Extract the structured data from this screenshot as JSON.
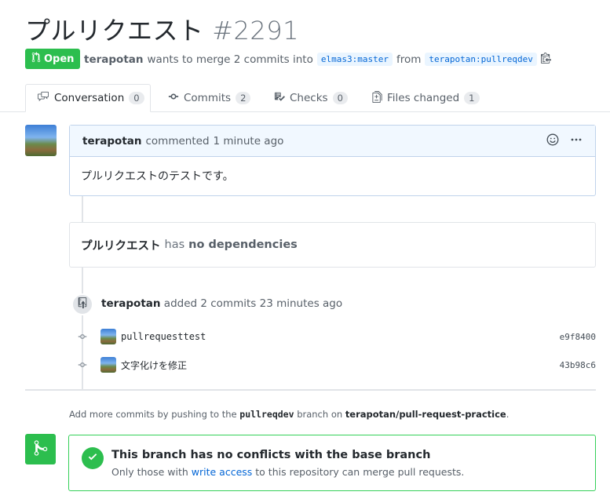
{
  "pr": {
    "title": "プルリクエスト",
    "number": "#2291",
    "state": "Open",
    "author": "terapotan",
    "merge_text_1": "wants to merge 2 commits into",
    "base_branch": "elmas3:master",
    "merge_text_2": "from",
    "head_branch": "terapotan:pullreqdev"
  },
  "tabs": [
    {
      "label": "Conversation",
      "count": "0"
    },
    {
      "label": "Commits",
      "count": "2"
    },
    {
      "label": "Checks",
      "count": "0"
    },
    {
      "label": "Files changed",
      "count": "1"
    }
  ],
  "comment": {
    "author": "terapotan",
    "action": "commented",
    "time": "1 minute ago",
    "body": "プルリクエストのテストです。"
  },
  "dependencies": {
    "title": "プルリクエスト",
    "has": "has",
    "status": "no dependencies"
  },
  "commit_event": {
    "author": "terapotan",
    "text": "added 2 commits",
    "time": "23 minutes ago",
    "commits": [
      {
        "message": "pullrequesttest",
        "sha": "e9f8400"
      },
      {
        "message": "文字化けを修正",
        "sha": "43b98c6"
      }
    ]
  },
  "push_hint": {
    "text1": "Add more commits by pushing to the",
    "branch": "pullreqdev",
    "text2": "branch on",
    "repo": "terapotan/pull-request-practice",
    "text3": "."
  },
  "merge": {
    "title": "This branch has no conflicts with the base branch",
    "sub1": "Only those with",
    "link": "write access",
    "sub2": "to this repository can merge pull requests."
  },
  "colors": {
    "open_green": "#2cbe4e",
    "link_blue": "#0366d6",
    "comment_header_bg": "#f1f8ff"
  }
}
